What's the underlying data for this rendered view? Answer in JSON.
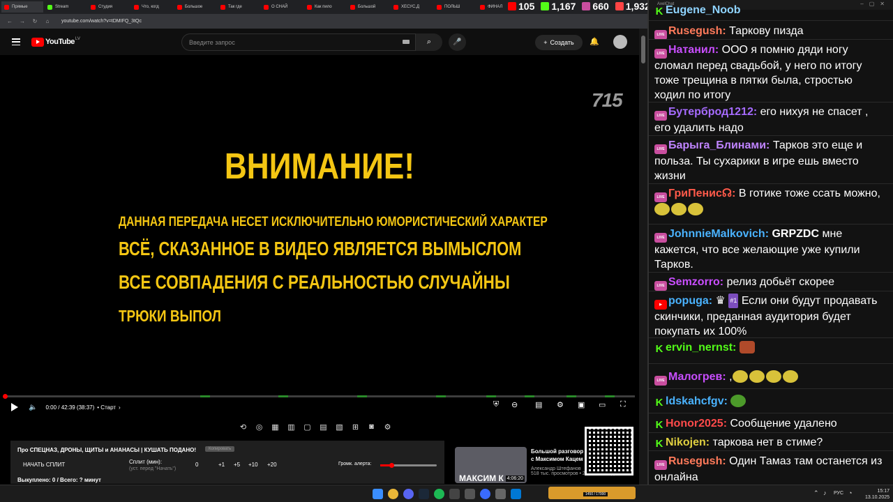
{
  "browser": {
    "tabs": [
      "Прямые",
      "Stream",
      "Студия",
      "Что, когд",
      "Большое",
      "Так где",
      "О СНАЙ",
      "Как пило",
      "Большой",
      "ХЕСУС,Д",
      "ПОЛЬШ",
      "ФИНАЛ"
    ],
    "url": "youtube.com/watch?v=tDMIFQ_3tQc"
  },
  "counters": [
    {
      "value": "105",
      "color": "#ff0000"
    },
    {
      "value": "1,167",
      "color": "#53fc18"
    },
    {
      "value": "660",
      "color": "#c94e9f"
    },
    {
      "value": "1,932",
      "color": "#ff4444"
    }
  ],
  "youtube": {
    "logo": "YouTube",
    "logo_country": "LV",
    "search_placeholder": "Введите запрос",
    "create_label": "Создать"
  },
  "video": {
    "watermark": "715",
    "title": "ВНИМАНИЕ!",
    "lines": [
      "ДАННАЯ ПЕРЕДАЧА НЕСЕТ ИСКЛЮЧИТЕЛЬНО ЮМОРИСТИЧЕСКИЙ ХАРАКТЕР",
      "ВСЁ, СКАЗАННОЕ В ВИДЕО ЯВЛЯЕТСЯ ВЫМЫСЛОМ",
      "ВСЕ СОВПАДЕНИЯ С РЕАЛЬНОСТЬЮ СЛУЧАЙНЫ",
      "ТРЮКИ ВЫПОЛ"
    ],
    "time": "0:00 / 42:39 (38:37)",
    "chapter": "• Старт",
    "progress": 0
  },
  "panel": {
    "title": "Про СПЕЦНАЗ, ДРОНЫ, ЩИТЫ и АНАНАСЫ | КУШАТЬ ПОДАНО!",
    "badge": "Копировать",
    "start_split": "НАЧАТЬ СПЛИТ",
    "split_label": "Сплит (мин):",
    "split_hint": "(уст. перед \"Начать\")",
    "split_value": "0",
    "buttons": [
      "+1",
      "+5",
      "+10",
      "+20"
    ],
    "volume_label": "Громк. алерта:",
    "volume_level": 0.2,
    "bought": "Выкуплено: 0 / Всего: ? минут"
  },
  "recommended": {
    "thumb_text": "МАКСИМ К",
    "duration": "4:06:20",
    "title": "Большой разговор с Максимом Кацем",
    "channel": "Александр Штефанов",
    "meta": "518 тыс. просмотров • 23 часа назад"
  },
  "chat": {
    "window_title": "AxelChat",
    "messages": [
      {
        "platform": "kick",
        "nick": "Eugene_Noob",
        "color": "#8fd4ff",
        "text": ""
      },
      {
        "platform": "live",
        "nick": "Rusegush:",
        "color": "#ff7a5a",
        "text": "Таркову пизда"
      },
      {
        "platform": "live",
        "nick": "Натанил:",
        "color": "#c94eff",
        "text": "ООО я помню дяди ногу сломал перед свадьбой, у него по итогу тоже трещина в пятки была, стростью ходил по итогу"
      },
      {
        "platform": "live",
        "nick": "Бутерброд1212:",
        "color": "#a66bff",
        "text": "его нихуя не спасет , его удалить надо"
      },
      {
        "platform": "live",
        "nick": "Барыга_Блинами:",
        "color": "#c084ff",
        "text": "Тарков это еще и польза. Ты сухарики в игре ешь вместо жизни"
      },
      {
        "platform": "live",
        "nick": "ГриПенис☊:",
        "color": "#ff5a4a",
        "text": "В готике тоже ссать можно,"
      },
      {
        "platform": "live",
        "nick": "JohnnieMalkovich:",
        "color": "#4ab3ff",
        "text": "мне кажется, что все желающие уже купили Тарков.",
        "bold": "GRPZDC"
      },
      {
        "platform": "live",
        "nick": "Semzorro:",
        "color": "#c94eff",
        "text": "релиз добьёт скорее"
      },
      {
        "platform": "yt",
        "nick": "popuga:",
        "color": "#4ab3ff",
        "text": "Если они будут продавать скинчики, преданная аудитория будет покупать их 100%",
        "badge": "#1"
      },
      {
        "platform": "kick",
        "nick": "ervin_nernst:",
        "color": "#53fc18",
        "text": ""
      },
      {
        "platform": "live",
        "nick": "Малогрев:",
        "color": "#c94eff",
        "text": ","
      },
      {
        "platform": "kick",
        "nick": "ldskahcfgv:",
        "color": "#4ab3ff",
        "text": ""
      },
      {
        "platform": "kick",
        "nick": "Honor2025:",
        "color": "#ff4a4a",
        "text": "Сообщение удалено"
      },
      {
        "platform": "kick",
        "nick": "Nikojen:",
        "color": "#e0d040",
        "text": "таркова нет в стиме?"
      },
      {
        "platform": "live",
        "nick": "Rusegush:",
        "color": "#ff7a5a",
        "text": "Один Тамаз там останется из онлайна"
      }
    ]
  },
  "taskbar": {
    "lang": "РУС",
    "time": "15:17",
    "date": "13.10.2025",
    "game_text": "1450 / 17000"
  }
}
